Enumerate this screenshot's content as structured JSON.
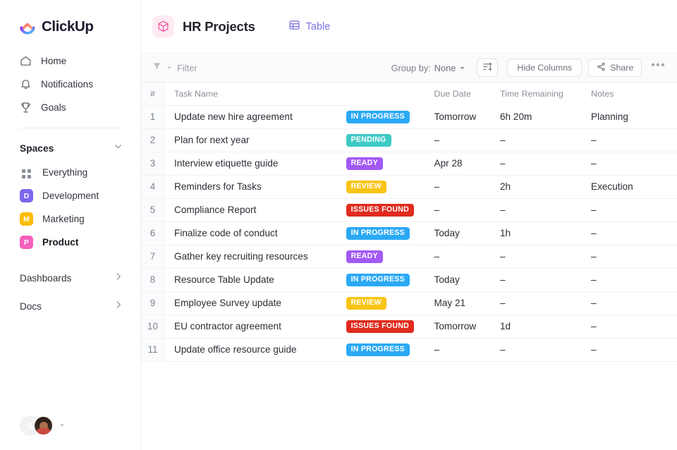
{
  "brand": {
    "name": "ClickUp",
    "logo_icon": "clickup-logo-icon"
  },
  "sidebar": {
    "nav": [
      {
        "label": "Home",
        "icon": "home-icon"
      },
      {
        "label": "Notifications",
        "icon": "bell-icon"
      },
      {
        "label": "Goals",
        "icon": "trophy-icon"
      }
    ],
    "spaces_header": {
      "title": "Spaces",
      "chevron_icon": "chevron-down-icon"
    },
    "spaces": [
      {
        "label": "Everything",
        "icon": "grid-dots-icon",
        "initial": "",
        "color": "",
        "active": false
      },
      {
        "label": "Development",
        "icon": "space-badge",
        "initial": "D",
        "color": "#7b68ee",
        "active": false
      },
      {
        "label": "Marketing",
        "icon": "space-badge",
        "initial": "M",
        "color": "#fbbc04",
        "active": false
      },
      {
        "label": "Product",
        "icon": "space-badge",
        "initial": "P",
        "color": "#f660bc",
        "active": true
      }
    ],
    "links": [
      {
        "label": "Dashboards",
        "icon": "chevron-right-icon"
      },
      {
        "label": "Docs",
        "icon": "chevron-right-icon"
      }
    ],
    "user": {
      "initial": "S",
      "avatar_icon": "user-avatar",
      "chevron_icon": "chevron-down-icon"
    }
  },
  "header": {
    "project_icon": "cube-icon",
    "project_title": "HR Projects",
    "view_tab": {
      "label": "Table",
      "icon": "table-icon",
      "color": "#7b73e0"
    }
  },
  "toolbar": {
    "filter": {
      "label": "Filter",
      "icon": "filter-icon",
      "caret_icon": "caret-down-icon"
    },
    "group_by_label": "Group by:",
    "group_by_value": "None",
    "group_by_caret": "caret-down-icon",
    "sort_button_icon": "sort-icon",
    "hide_columns_label": "Hide Columns",
    "share_label": "Share",
    "share_icon": "share-icon",
    "more_label": "•••"
  },
  "table": {
    "columns": [
      "#",
      "Task Name",
      "",
      "Due Date",
      "Time Remaining",
      "Notes"
    ],
    "status_colors": {
      "IN PROGRESS": "#2ba9f5",
      "PENDING": "#3ecac6",
      "READY": "#a259f5",
      "REVIEW": "#f9c414",
      "ISSUES FOUND": "#e02b1e"
    },
    "rows": [
      {
        "num": "1",
        "task": "Update new hire agreement",
        "status": "IN PROGRESS",
        "due": "Tomorrow",
        "due_overdue": false,
        "time": "6h 20m",
        "notes": "Planning"
      },
      {
        "num": "2",
        "task": "Plan for next year",
        "status": "PENDING",
        "due": "–",
        "due_overdue": false,
        "time": "–",
        "notes": "–"
      },
      {
        "num": "3",
        "task": "Interview etiquette guide",
        "status": "READY",
        "due": "Apr 28",
        "due_overdue": true,
        "time": "–",
        "notes": "–"
      },
      {
        "num": "4",
        "task": "Reminders for Tasks",
        "status": "REVIEW",
        "due": "–",
        "due_overdue": false,
        "time": "2h",
        "notes": "Execution"
      },
      {
        "num": "5",
        "task": "Compliance Report",
        "status": "ISSUES FOUND",
        "due": "–",
        "due_overdue": false,
        "time": "–",
        "notes": "–"
      },
      {
        "num": "6",
        "task": "Finalize code of conduct",
        "status": "IN PROGRESS",
        "due": "Today",
        "due_overdue": true,
        "time": "1h",
        "notes": "–"
      },
      {
        "num": "7",
        "task": "Gather key recruiting resources",
        "status": "READY",
        "due": "–",
        "due_overdue": false,
        "time": "–",
        "notes": "–"
      },
      {
        "num": "8",
        "task": "Resource Table Update",
        "status": "IN PROGRESS",
        "due": "Today",
        "due_overdue": true,
        "time": "–",
        "notes": "–"
      },
      {
        "num": "9",
        "task": "Employee Survey update",
        "status": "REVIEW",
        "due": "May 21",
        "due_overdue": false,
        "time": "–",
        "notes": "–"
      },
      {
        "num": "10",
        "task": "EU contractor agreement",
        "status": "ISSUES FOUND",
        "due": "Tomorrow",
        "due_overdue": false,
        "time": "1d",
        "notes": "–"
      },
      {
        "num": "11",
        "task": "Update office resource guide",
        "status": "IN PROGRESS",
        "due": "–",
        "due_overdue": false,
        "time": "–",
        "notes": "–"
      }
    ]
  }
}
